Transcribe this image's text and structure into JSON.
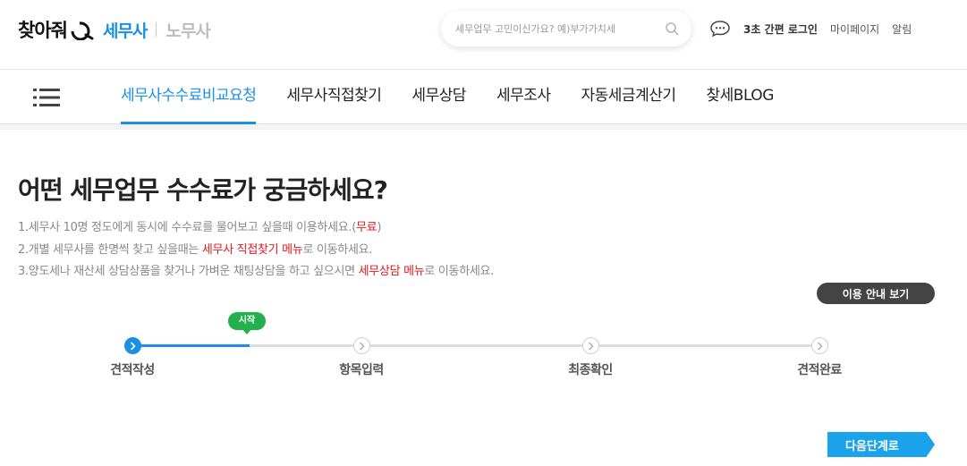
{
  "header": {
    "logo_main": "찾아줘",
    "logo_sub_active": "세무사",
    "logo_sub_inactive": "노무사",
    "search_placeholder": "세무업무 고민이신가요? 예)부가가치세",
    "links": {
      "quick_login": "3초 간편 로그인",
      "mypage": "마이페이지",
      "alerts": "알림"
    }
  },
  "nav": {
    "items": [
      {
        "label": "세무사수수료비교요청",
        "active": true
      },
      {
        "label": "세무사직접찾기"
      },
      {
        "label": "세무상담"
      },
      {
        "label": "세무조사"
      },
      {
        "label": "자동세금계산기"
      },
      {
        "label": "찾세BLOG"
      }
    ]
  },
  "main": {
    "title": "어떤 세무업무 수수료가 궁금하세요?",
    "desc": {
      "line1_pre": "1.세무사 10명 정도에게 동시에 수수료를 물어보고 싶을때 이용하세요.(",
      "line1_hl": "무료",
      "line1_post": ")",
      "line2_pre": "2.개별 세무사를 한명씩 찾고 싶을때는 ",
      "line2_hl": "세무사 직접찾기 메뉴",
      "line2_post": "로 이동하세요.",
      "line3_pre": "3.양도세나 재산세 상담상품을 찾거나 가벼운 채팅상담을 하고 싶으시면 ",
      "line3_hl": "세무상담 메뉴",
      "line3_post": "로 이동하세요."
    },
    "guide_button": "이용 안내 보기",
    "next_button": "다음단계로"
  },
  "steps": {
    "start_badge": "시작",
    "progress_fraction": 0.17,
    "items": [
      {
        "label": "견적작성",
        "state": "current"
      },
      {
        "label": "항목입력",
        "state": "pending"
      },
      {
        "label": "최종확인",
        "state": "pending"
      },
      {
        "label": "견적완료",
        "state": "pending"
      }
    ]
  },
  "colors": {
    "accent": "#1a8fe3",
    "highlight": "#e0181c",
    "badge": "#22b14c",
    "next_button": "#1aa3ea"
  }
}
